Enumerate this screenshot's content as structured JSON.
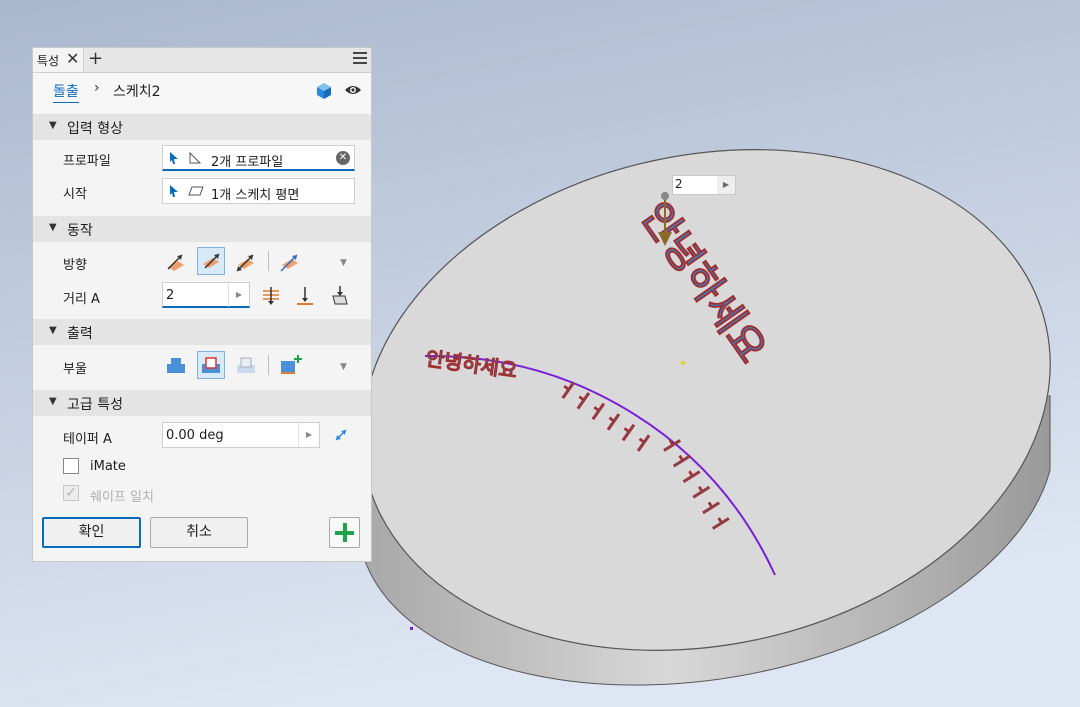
{
  "panel": {
    "tab_label": "특성",
    "tab_close": "✕",
    "tab_add": "+",
    "breadcrumb_link": "돌출",
    "breadcrumb_sep": "›",
    "breadcrumb_current": "스케치2"
  },
  "input_shape": {
    "title": "입력 형상",
    "profile_label": "프로파일",
    "profile_value": "2개 프로파일",
    "start_label": "시작",
    "start_value": "1개 스케치 평면"
  },
  "behavior": {
    "title": "동작",
    "direction_label": "방향",
    "distance_label": "거리 A",
    "distance_value": "2"
  },
  "output": {
    "title": "출력",
    "boolean_label": "부울"
  },
  "advanced": {
    "title": "고급 특성",
    "taper_label": "테이퍼 A",
    "taper_value": "0.00 deg",
    "imate_label": "iMate",
    "match_shape_label": "쉐이프 일치"
  },
  "buttons": {
    "ok": "확인",
    "cancel": "취소"
  },
  "viewport": {
    "distance_input_value": "2"
  },
  "colors": {
    "accent": "#0a6bbd",
    "text_3d": "#2a8ae0",
    "path_line": "#7a1fd6",
    "plus_green": "#1ea24a"
  }
}
